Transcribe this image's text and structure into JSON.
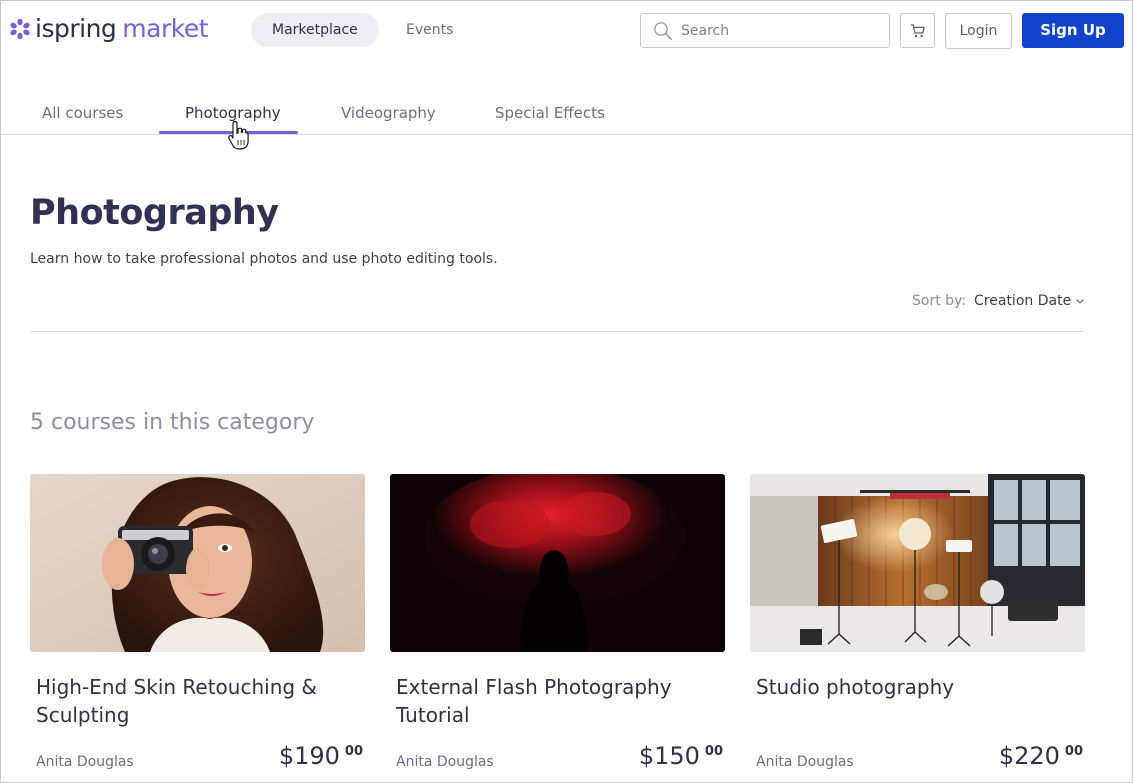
{
  "header": {
    "logo": {
      "part1": "ispring",
      "part2": "market"
    },
    "nav": [
      {
        "label": "Marketplace",
        "active": true
      },
      {
        "label": "Events",
        "active": false
      }
    ],
    "search": {
      "placeholder": "Search",
      "value": ""
    },
    "cart_icon": "shopping-cart-icon",
    "login_label": "Login",
    "signup_label": "Sign Up",
    "accent_color": "#1145c9"
  },
  "tabs": [
    {
      "label": "All courses",
      "active": false
    },
    {
      "label": "Photography",
      "active": true
    },
    {
      "label": "Videography",
      "active": false
    },
    {
      "label": "Special Effects",
      "active": false
    }
  ],
  "tab_accent_color": "#7b5ed9",
  "page": {
    "title": "Photography",
    "description": "Learn how to take professional photos and use photo editing tools.",
    "sort_label": "Sort by:",
    "sort_value": "Creation Date",
    "course_count_text": "5 courses in this category"
  },
  "courses": [
    {
      "title": "High-End Skin Retouching & Sculpting",
      "author": "Anita Douglas",
      "price_main": "$190",
      "price_cents": "00",
      "image": "woman-with-camera"
    },
    {
      "title": "External Flash Photography Tutorial",
      "author": "Anita Douglas",
      "price_main": "$150",
      "price_cents": "00",
      "image": "hooded-figure-red-smoke"
    },
    {
      "title": "Studio photography",
      "author": "Anita Douglas",
      "price_main": "$220",
      "price_cents": "00",
      "image": "photo-studio-interior"
    }
  ]
}
